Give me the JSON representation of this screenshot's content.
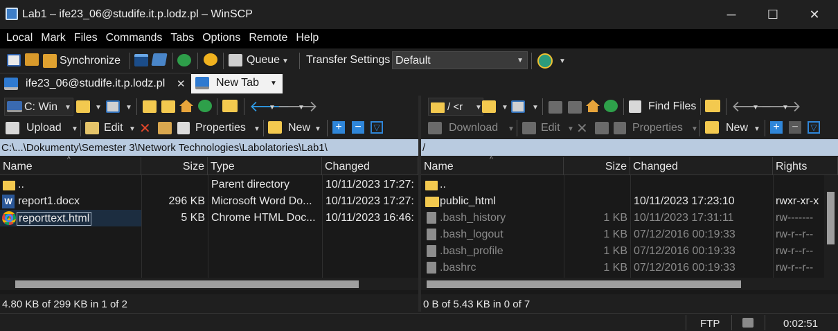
{
  "window": {
    "title": "Lab1 – ife23_06@studife.it.p.lodz.pl – WinSCP",
    "minimize": "─",
    "maximize": "☐",
    "close": "✕"
  },
  "menu": [
    "Local",
    "Mark",
    "Files",
    "Commands",
    "Tabs",
    "Options",
    "Remote",
    "Help"
  ],
  "toolbar": {
    "synchronize": "Synchronize",
    "queue": "Queue",
    "transfer_settings_label": "Transfer Settings",
    "transfer_settings_value": "Default"
  },
  "tabs": [
    {
      "label": "ife23_06@studife.it.p.lodz.pl",
      "close": "✕"
    },
    {
      "label": "New Tab"
    }
  ],
  "left": {
    "drive": "C: Win",
    "actions": {
      "upload": "Upload",
      "edit": "Edit",
      "properties": "Properties",
      "new": "New"
    },
    "path": "C:\\...\\Dokumenty\\Semester 3\\Network Technologies\\Labolatories\\Lab1\\",
    "columns": {
      "name": "Name",
      "size": "Size",
      "type": "Type",
      "changed": "Changed"
    },
    "files": [
      {
        "name": "..",
        "size": "",
        "type": "Parent directory",
        "changed": "10/11/2023 17:27:"
      },
      {
        "name": "report1.docx",
        "size": "296 KB",
        "type": "Microsoft Word Do...",
        "changed": "10/11/2023 17:27:"
      },
      {
        "name": "reporttext.html",
        "size": "5 KB",
        "type": "Chrome HTML Doc...",
        "changed": "10/11/2023 16:46:"
      }
    ],
    "status": "4.80 KB of 299 KB in 1 of 2"
  },
  "right": {
    "drive": "/ <r",
    "find_files": "Find Files",
    "actions": {
      "download": "Download",
      "edit": "Edit",
      "properties": "Properties",
      "new": "New"
    },
    "path": "/",
    "columns": {
      "name": "Name",
      "size": "Size",
      "changed": "Changed",
      "rights": "Rights"
    },
    "files": [
      {
        "name": "..",
        "size": "",
        "changed": "",
        "rights": ""
      },
      {
        "name": "public_html",
        "size": "",
        "changed": "10/11/2023 17:23:10",
        "rights": "rwxr-xr-x"
      },
      {
        "name": ".bash_history",
        "size": "1 KB",
        "changed": "10/11/2023 17:31:11",
        "rights": "rw-------"
      },
      {
        "name": ".bash_logout",
        "size": "1 KB",
        "changed": "07/12/2016 00:19:33",
        "rights": "rw-r--r--"
      },
      {
        "name": ".bash_profile",
        "size": "1 KB",
        "changed": "07/12/2016 00:19:33",
        "rights": "rw-r--r--"
      },
      {
        "name": ".bashrc",
        "size": "1 KB",
        "changed": "07/12/2016 00:19:33",
        "rights": "rw-r--r--"
      }
    ],
    "status": "0 B of 5.43 KB in 0 of 7"
  },
  "statusbar": {
    "protocol": "FTP",
    "time": "0:02:51"
  },
  "colors": {
    "accent": "#1e90ff",
    "path_bg": "#b9cbe0",
    "selection": "#1c2d40",
    "folder": "#f3c94f"
  }
}
